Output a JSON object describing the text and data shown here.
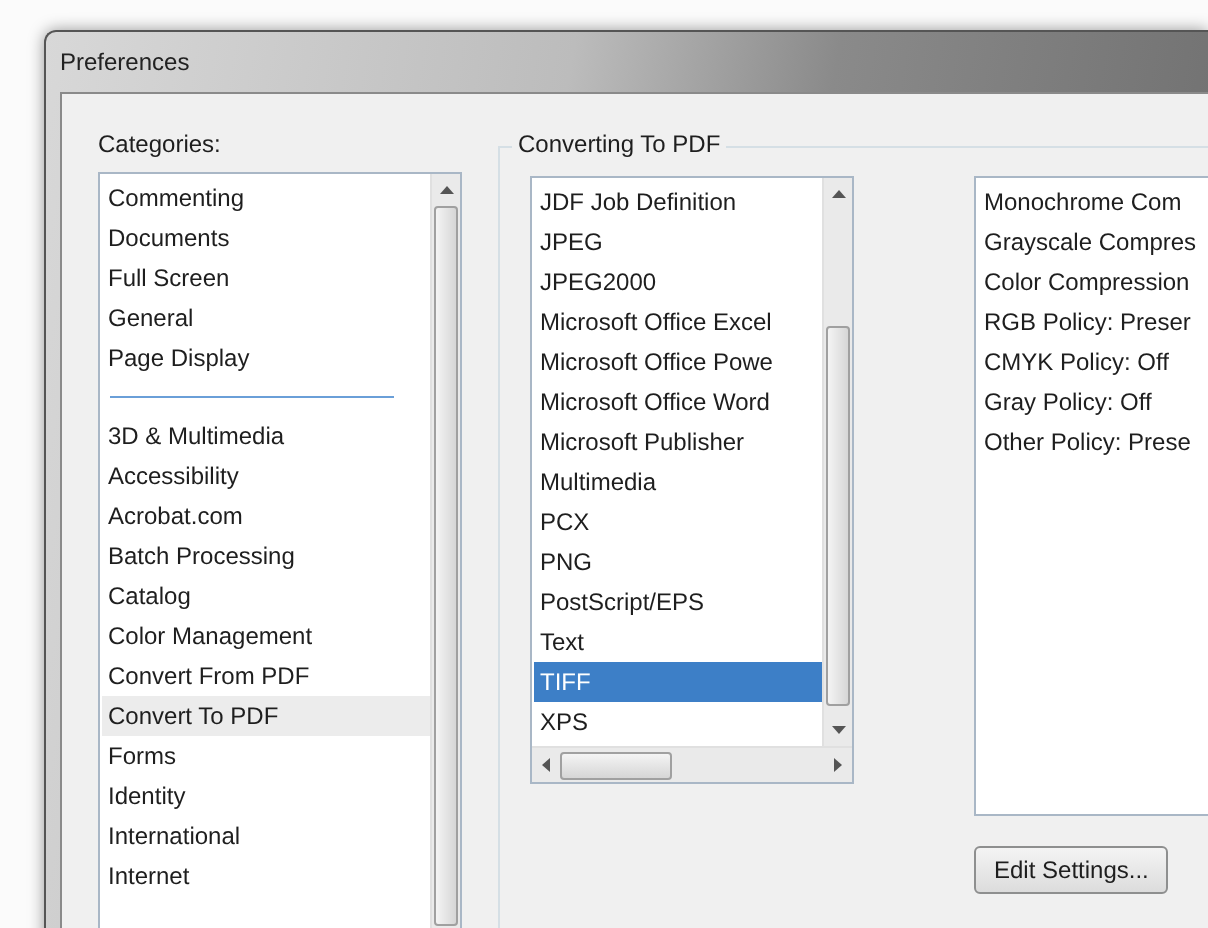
{
  "window": {
    "title": "Preferences"
  },
  "categories": {
    "label": "Categories:",
    "groups": [
      [
        {
          "label": "Commenting",
          "selected": false
        },
        {
          "label": "Documents",
          "selected": false
        },
        {
          "label": "Full Screen",
          "selected": false
        },
        {
          "label": "General",
          "selected": false
        },
        {
          "label": "Page Display",
          "selected": false
        }
      ],
      [
        {
          "label": "3D & Multimedia",
          "selected": false
        },
        {
          "label": "Accessibility",
          "selected": false
        },
        {
          "label": "Acrobat.com",
          "selected": false
        },
        {
          "label": "Batch Processing",
          "selected": false
        },
        {
          "label": "Catalog",
          "selected": false
        },
        {
          "label": "Color Management",
          "selected": false
        },
        {
          "label": "Convert From PDF",
          "selected": false
        },
        {
          "label": "Convert To PDF",
          "selected": true
        },
        {
          "label": "Forms",
          "selected": false
        },
        {
          "label": "Identity",
          "selected": false
        },
        {
          "label": "International",
          "selected": false
        },
        {
          "label": "Internet",
          "selected": false
        }
      ]
    ]
  },
  "converting": {
    "title": "Converting To PDF",
    "formats": [
      {
        "label": "JDF Job Definition",
        "selected": false
      },
      {
        "label": "JPEG",
        "selected": false
      },
      {
        "label": "JPEG2000",
        "selected": false
      },
      {
        "label": "Microsoft Office Excel",
        "selected": false
      },
      {
        "label": "Microsoft Office Powe",
        "selected": false
      },
      {
        "label": "Microsoft Office Word",
        "selected": false
      },
      {
        "label": "Microsoft Publisher",
        "selected": false
      },
      {
        "label": "Multimedia",
        "selected": false
      },
      {
        "label": "PCX",
        "selected": false
      },
      {
        "label": "PNG",
        "selected": false
      },
      {
        "label": "PostScript/EPS",
        "selected": false
      },
      {
        "label": "Text",
        "selected": false
      },
      {
        "label": "TIFF",
        "selected": true
      },
      {
        "label": "XPS",
        "selected": false
      }
    ],
    "settings": [
      "Monochrome Com",
      "Grayscale Compres",
      "Color Compression",
      "RGB Policy: Preser",
      "CMYK Policy: Off",
      "Gray Policy: Off",
      "Other Policy: Prese"
    ],
    "edit_button": "Edit Settings..."
  }
}
